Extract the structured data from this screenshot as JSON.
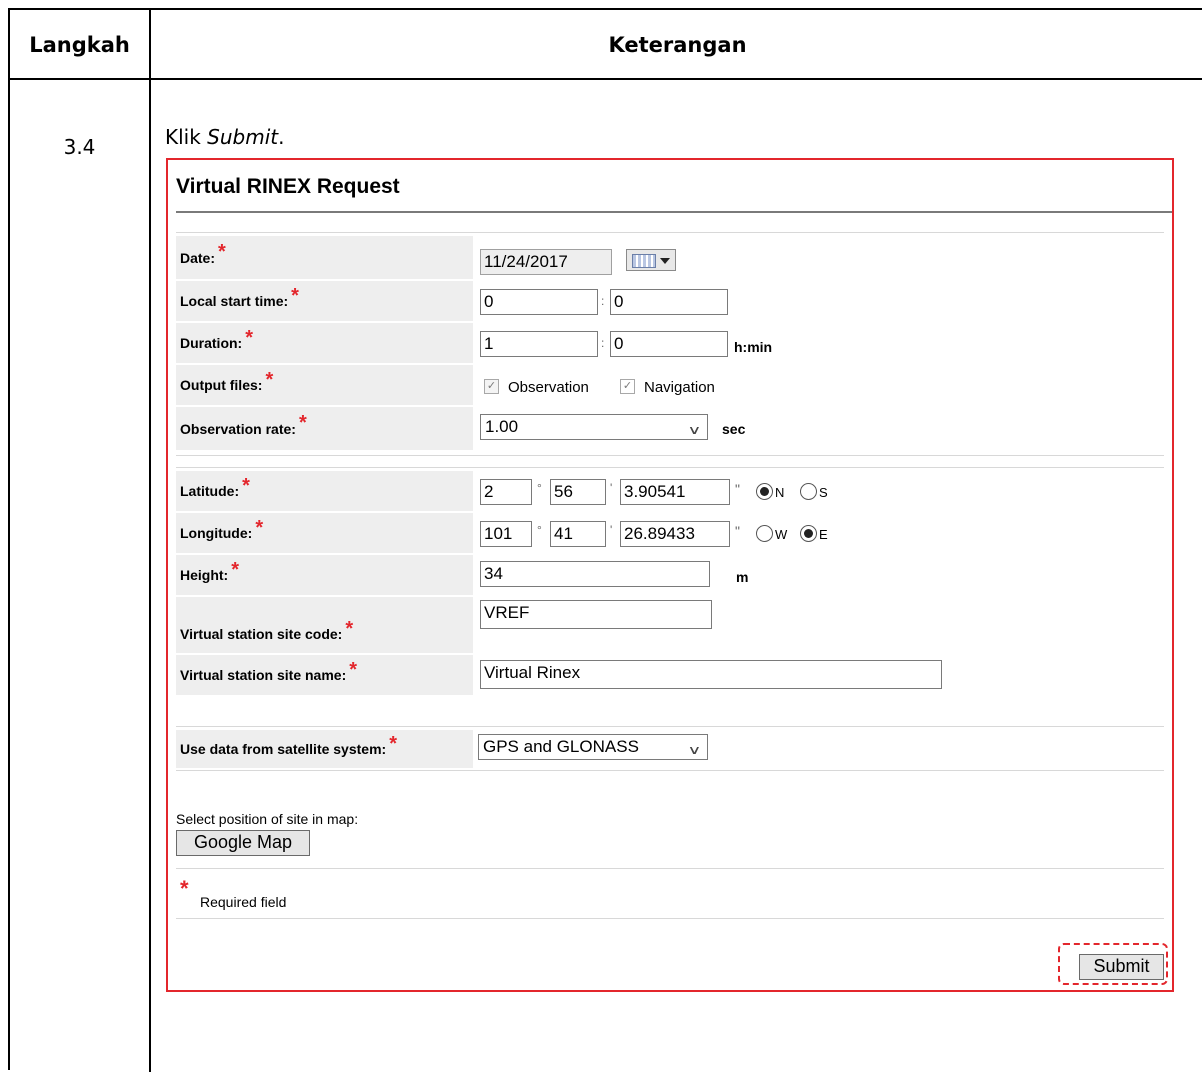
{
  "doc": {
    "col1_header": "Langkah",
    "col2_header": "Keterangan",
    "step_number": "3.4",
    "instruction_prefix": "Klik ",
    "instruction_emphasis": "Submit",
    "instruction_suffix": "."
  },
  "form": {
    "title": "Virtual RINEX Request",
    "date_label": "Date:",
    "date_value": "11/24/2017",
    "start_label": "Local start time:",
    "start_h": "0",
    "start_m": "0",
    "duration_label": "Duration:",
    "duration_h": "1",
    "duration_m": "0",
    "duration_unit": "h:min",
    "output_label": "Output files:",
    "obs_label": "Observation",
    "obs_checked": true,
    "nav_label": "Navigation",
    "nav_checked": true,
    "rate_label": "Observation rate:",
    "rate_value": "1.00",
    "rate_unit": "sec",
    "lat_label": "Latitude:",
    "lat_deg": "2",
    "lat_min": "56",
    "lat_sec": "3.90541",
    "lat_n": "N",
    "lat_s": "S",
    "lat_selected": "N",
    "lon_label": "Longitude:",
    "lon_deg": "101",
    "lon_min": "41",
    "lon_sec": "26.89433",
    "lon_w": "W",
    "lon_e": "E",
    "lon_selected": "E",
    "height_label": "Height:",
    "height_value": "34",
    "height_unit": "m",
    "site_code_label": "Virtual station site code:",
    "site_code_value": "VREF",
    "site_name_label": "Virtual station site name:",
    "site_name_value": "Virtual Rinex",
    "sat_label": "Use data from satellite system:",
    "sat_value": "GPS and GLONASS",
    "map_hint": "Select position of site in map:",
    "map_button": "Google Map",
    "required_note": "Required field",
    "submit_button": "Submit",
    "required_mark": "*"
  },
  "colors": {
    "highlight": "#e3262c",
    "label_bg": "#eeeeee"
  }
}
